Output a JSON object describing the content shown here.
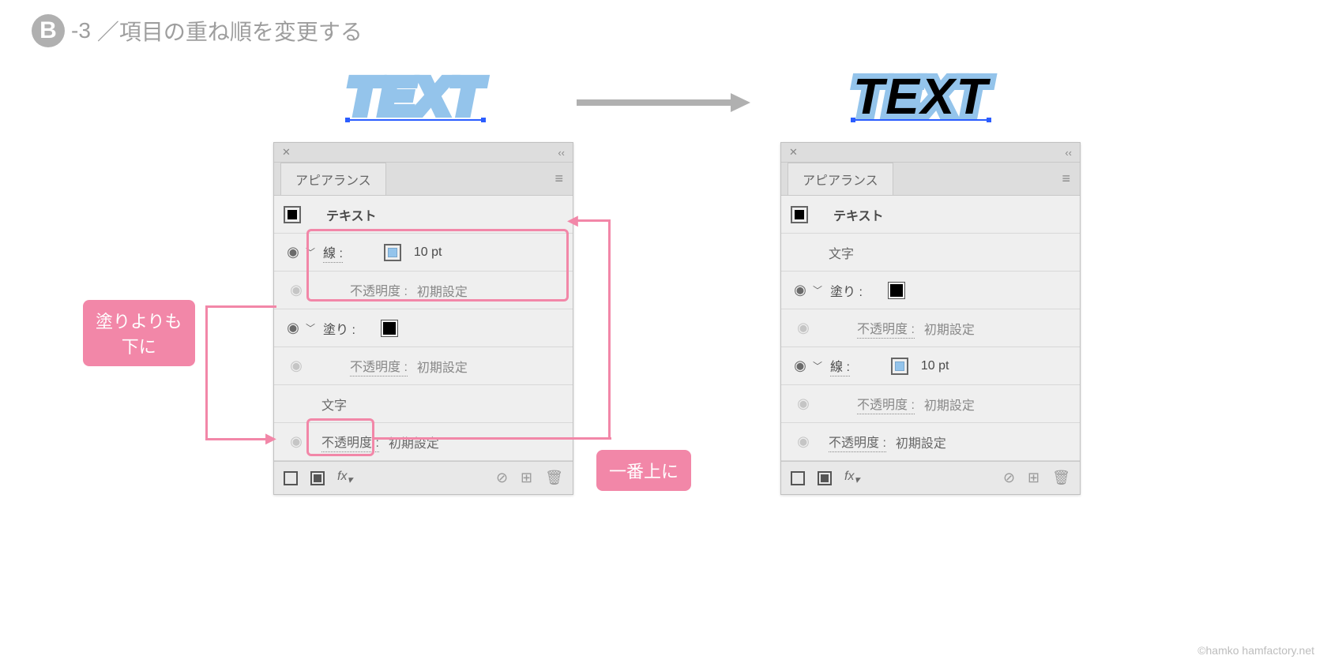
{
  "heading": {
    "badge": "B",
    "suffix": "-3",
    "title": "／項目の重ね順を変更する"
  },
  "sample": {
    "text": "TEXT"
  },
  "panels": {
    "tab": "アピアランス",
    "left": {
      "title": "テキスト",
      "rows": [
        {
          "label": "線 :",
          "value": "10 pt",
          "swatch": "blue"
        },
        {
          "label": "不透明度 :",
          "value": "初期設定"
        },
        {
          "label": "塗り :",
          "swatch": "black"
        },
        {
          "label": "不透明度 :",
          "value": "初期設定"
        },
        {
          "label": "文字"
        },
        {
          "label": "不透明度 :",
          "value": "初期設定"
        }
      ]
    },
    "right": {
      "title": "テキスト",
      "rows": [
        {
          "label": "文字"
        },
        {
          "label": "塗り :",
          "swatch": "black"
        },
        {
          "label": "不透明度 :",
          "value": "初期設定"
        },
        {
          "label": "線 :",
          "value": "10 pt",
          "swatch": "blue"
        },
        {
          "label": "不透明度 :",
          "value": "初期設定"
        },
        {
          "label": "不透明度 :",
          "value": "初期設定"
        }
      ]
    },
    "fx": "fx"
  },
  "callouts": {
    "below_fill": "塗りよりも\n下に",
    "to_top": "一番上に"
  },
  "credit": "©hamko hamfactory.net"
}
